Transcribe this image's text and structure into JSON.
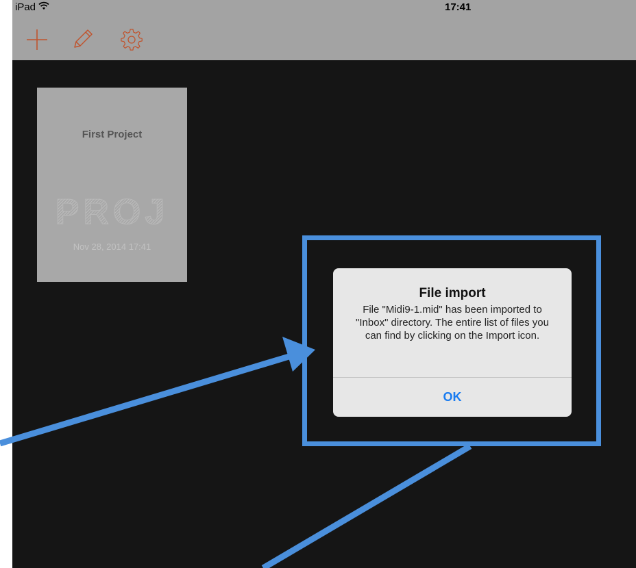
{
  "status_bar": {
    "device": "iPad",
    "wifi_icon": "wifi-icon",
    "time": "17:41"
  },
  "toolbar": {
    "accent_color": "#c0542e",
    "buttons": [
      {
        "icon": "plus-icon"
      },
      {
        "icon": "pencil-icon"
      },
      {
        "icon": "gear-icon"
      }
    ]
  },
  "project": {
    "title": "First Project",
    "mark": "PROJ",
    "date": "Nov 28, 2014 17:41"
  },
  "alert": {
    "title": "File import",
    "message": "File \"Midi9-1.mid\" has been imported to \"Inbox\" directory. The entire list of files you can find by clicking on the Import icon.",
    "ok_label": "OK"
  },
  "annotation": {
    "color": "#4a8fdc"
  }
}
